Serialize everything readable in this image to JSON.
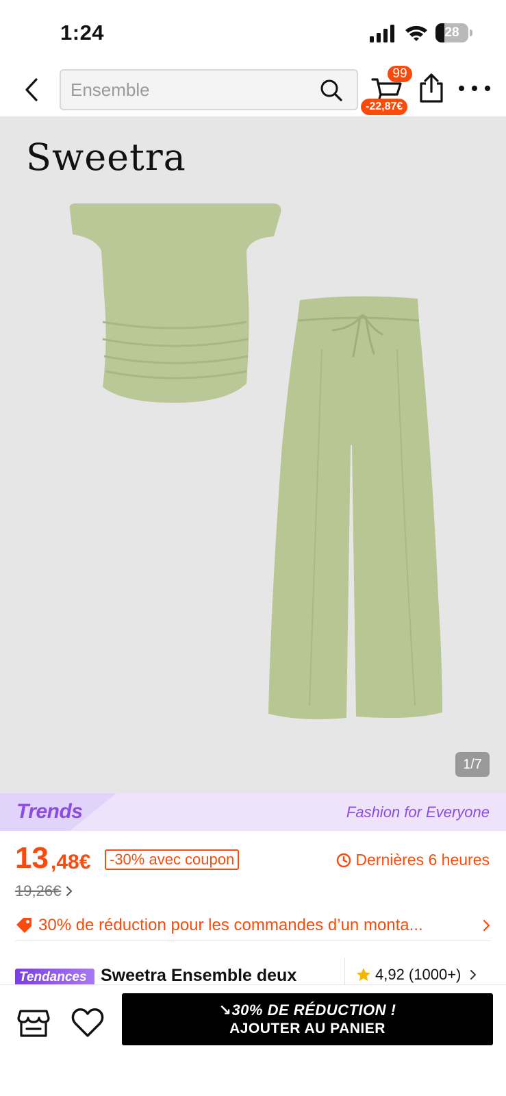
{
  "status_bar": {
    "time": "1:24",
    "battery_level": "28",
    "battery_fraction": 0.28
  },
  "nav": {
    "search_placeholder": "Ensemble",
    "cart_count": "99",
    "cart_discount": "-22,87€"
  },
  "product_image": {
    "brand": "Sweetra",
    "counter": "1/7",
    "colors": {
      "background": "#e6e6e6",
      "garment": "#b9c896"
    }
  },
  "trends_banner": {
    "logo": "Trends",
    "tagline": "Fashion for Everyone"
  },
  "price": {
    "integer": "13",
    "decimal": ",48€",
    "coupon": "-30% avec coupon",
    "timer": "Dernières 6 heures",
    "old_price": "19,26€"
  },
  "promo": {
    "text": "30% de réduction pour les commandes d’un monta..."
  },
  "title_row": {
    "badge": "Tendances",
    "title": "Sweetra Ensemble deux",
    "rating": "4,92 (1000+)"
  },
  "bottom_bar": {
    "cta_line1": "↘30% DE RÉDUCTION !",
    "cta_line2": "AJOUTER AU PANIER"
  },
  "colors": {
    "accent": "#fa4b0c",
    "trends_purple": "#8a4de0",
    "star": "#f5b400"
  },
  "icons": [
    "back-icon",
    "search-icon",
    "cart-icon",
    "share-icon",
    "more-icon",
    "clock-icon",
    "tag-icon",
    "star-icon",
    "chevron-right-icon",
    "store-icon",
    "heart-icon"
  ]
}
